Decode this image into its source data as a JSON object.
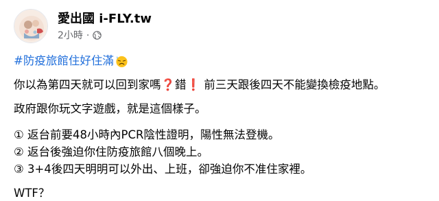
{
  "post": {
    "page_name": "愛出國 i-FLY.tw",
    "timestamp": "2小時",
    "separator": "·",
    "privacy_icon": "globe-icon",
    "hashtag": "#防疫旅館住好住滿",
    "hashtag_emoji": "sweat-emoji",
    "lines": {
      "l1_a": "你以為第四天就可以回到家嗎",
      "l1_q": "❓",
      "l1_b": "錯",
      "l1_e": "❗",
      "l1_c": " 前三天跟後四天不能變換檢疫地點。",
      "l2": "政府跟你玩文字遊戲，就是這個樣子。",
      "l3": "① 返台前要48小時內PCR陰性證明，陽性無法登機。",
      "l4": "② 返台後強迫你住防疫旅館八個晚上。",
      "l5": "③ 3+4後四天明明可以外出、上班，卻強迫你不准住家裡。",
      "l6": "WTF？"
    }
  },
  "colors": {
    "hashtag": "#216fdb",
    "meta": "#65676b",
    "text": "#050505",
    "red_mark": "#d0021b"
  }
}
